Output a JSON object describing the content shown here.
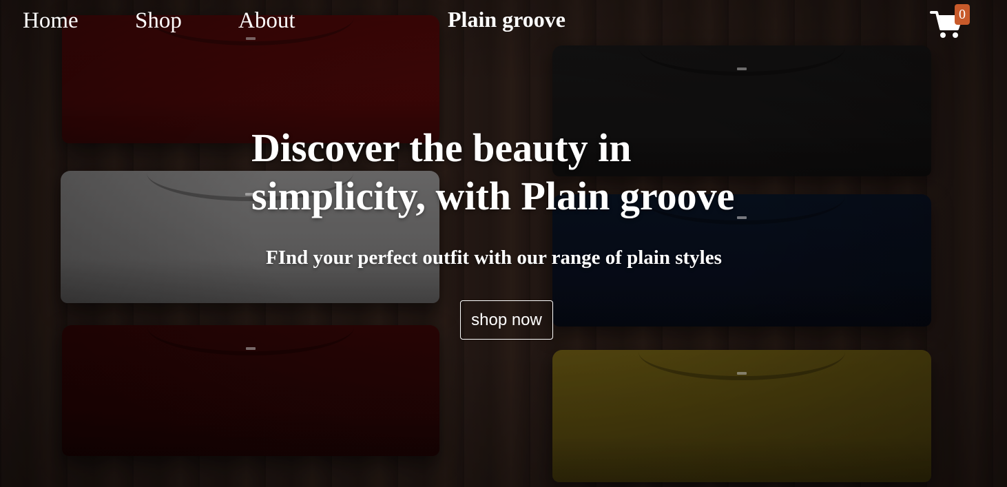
{
  "nav": {
    "home_label": "Home",
    "shop_label": "Shop",
    "about_label": "About"
  },
  "brand": {
    "name": "Plain groove"
  },
  "cart": {
    "icon": "cart-icon",
    "count": "0",
    "badge_color": "#c85a2a"
  },
  "hero": {
    "title": "Discover the beauty in simplicity, with Plain groove",
    "subtitle": "FInd your perfect outfit with our range of plain styles",
    "cta_label": "shop now"
  },
  "background": {
    "shirt_colors": [
      "#4a0707",
      "#7a7a7a",
      "#2c0404",
      "#141414",
      "#06101f",
      "#5e5010"
    ]
  }
}
